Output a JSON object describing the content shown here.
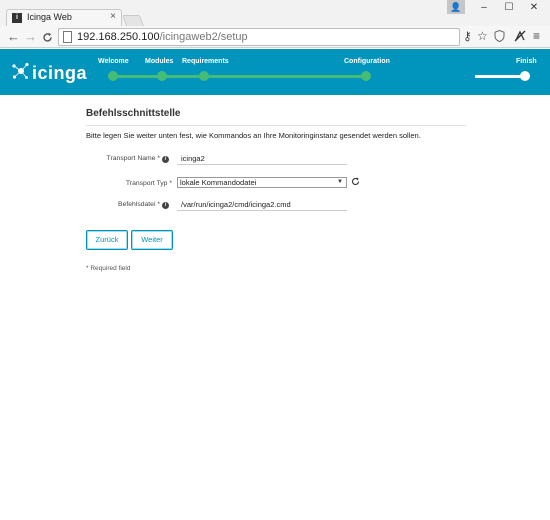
{
  "browser": {
    "tab_title": "Icinga Web",
    "tab_close": "×",
    "url_host": "192.168.250.100",
    "url_path": "/icingaweb2/setup",
    "back": "←",
    "forward": "→",
    "reload": "C",
    "window_controls": {
      "minimize": "–",
      "maximize": "☐",
      "close": "✕"
    }
  },
  "header": {
    "logo_text": "icinga",
    "steps": [
      {
        "label": "Welcome",
        "state": "done"
      },
      {
        "label": "Modules",
        "state": "done"
      },
      {
        "label": "Requirements",
        "state": "done"
      },
      {
        "label": "Configuration",
        "state": "active"
      },
      {
        "label": "Finish",
        "state": "pending"
      }
    ],
    "colors": {
      "bar": "#0195be",
      "done": "#44bb77",
      "pending": "#ffffff"
    }
  },
  "form": {
    "title": "Befehlsschnittstelle",
    "description": "Bitte legen Sie weiter unten fest, wie Kommandos an Ihre Monitoringinstanz gesendet werden sollen.",
    "fields": {
      "transport_name": {
        "label": "Transport Name *",
        "value": "icinga2"
      },
      "transport_type": {
        "label": "Transport Typ *",
        "value": "lokale Kommandodatei"
      },
      "command_file": {
        "label": "Befehlsdatei *",
        "value": "/var/run/icinga2/cmd/icinga2.cmd"
      }
    },
    "buttons": {
      "back": "Zurück",
      "next": "Weiter"
    },
    "required_note": "* Required field"
  }
}
